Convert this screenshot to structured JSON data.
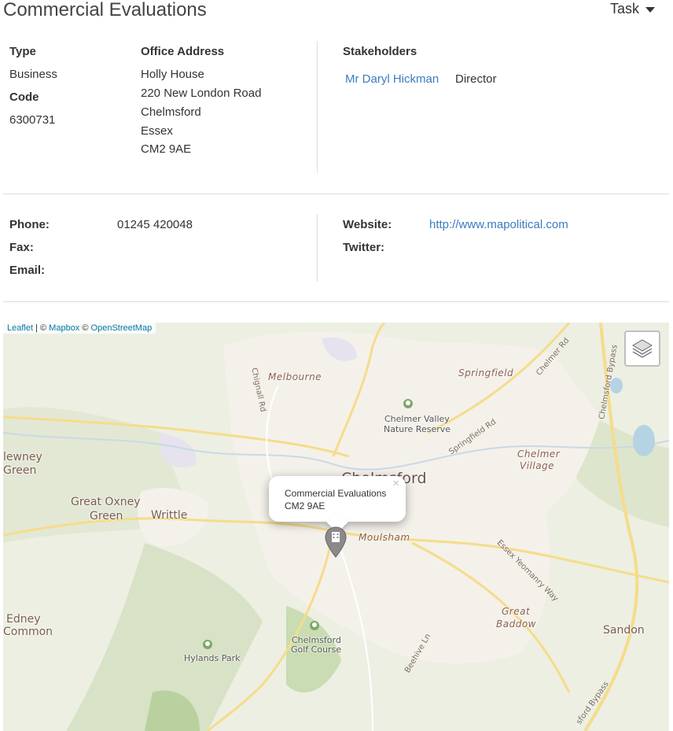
{
  "header": {
    "title": "Commercial Evaluations",
    "task_label": "Task"
  },
  "details": {
    "type_label": "Type",
    "type_value": "Business",
    "code_label": "Code",
    "code_value": "6300731",
    "address_label": "Office Address",
    "address_lines": [
      "Holly House",
      "220 New London Road",
      "Chelmsford",
      "Essex",
      "CM2 9AE"
    ],
    "stakeholders_label": "Stakeholders",
    "stakeholders": [
      {
        "name": "Mr Daryl Hickman",
        "role": "Director"
      }
    ]
  },
  "contact": {
    "phone_label": "Phone:",
    "phone_value": "01245 420048",
    "fax_label": "Fax:",
    "email_label": "Email:",
    "website_label": "Website:",
    "website_value": "http://www.mapolitical.com",
    "twitter_label": "Twitter:"
  },
  "map": {
    "attribution": {
      "leaflet": "Leaflet",
      "sep1": " | © ",
      "mapbox": "Mapbox",
      "sep2": " © ",
      "osm": "OpenStreetMap"
    },
    "popup": {
      "line1": "Commercial Evaluations",
      "line2": "CM2 9AE",
      "close": "×"
    },
    "places": {
      "melbourne": "Melbourne",
      "springfield": "Springfield",
      "chelmer_village_1": "Chelmer",
      "chelmer_village_2": "Village",
      "newney_1": "lewney",
      "newney_2": "Green",
      "great_oxney_1": "Great Oxney",
      "great_oxney_2": "Green",
      "writtle": "Writtle",
      "chelmsford": "Chelmsford",
      "moulsham": "Moulsham",
      "great_baddow_1": "Great",
      "great_baddow_2": "Baddow",
      "sandon": "Sandon",
      "edney_1": "Edney",
      "edney_2": "Common",
      "nature_reserve_1": "Chelmer Valley",
      "nature_reserve_2": "Nature Reserve",
      "golf_1": "Chelmsford",
      "golf_2": "Golf Course",
      "hylands": "Hylands Park"
    },
    "roads": {
      "chignall": "Chignall Rd",
      "chelmer_rd": "Chelmer Rd",
      "springfield_rd": "Springfield Rd",
      "bypass_top": "Chelmsford Bypass",
      "essex_yeomanry": "Essex Yeomanry Way",
      "beehive": "Beehive Ln",
      "bypass_bottom": "sford Bypass"
    }
  }
}
